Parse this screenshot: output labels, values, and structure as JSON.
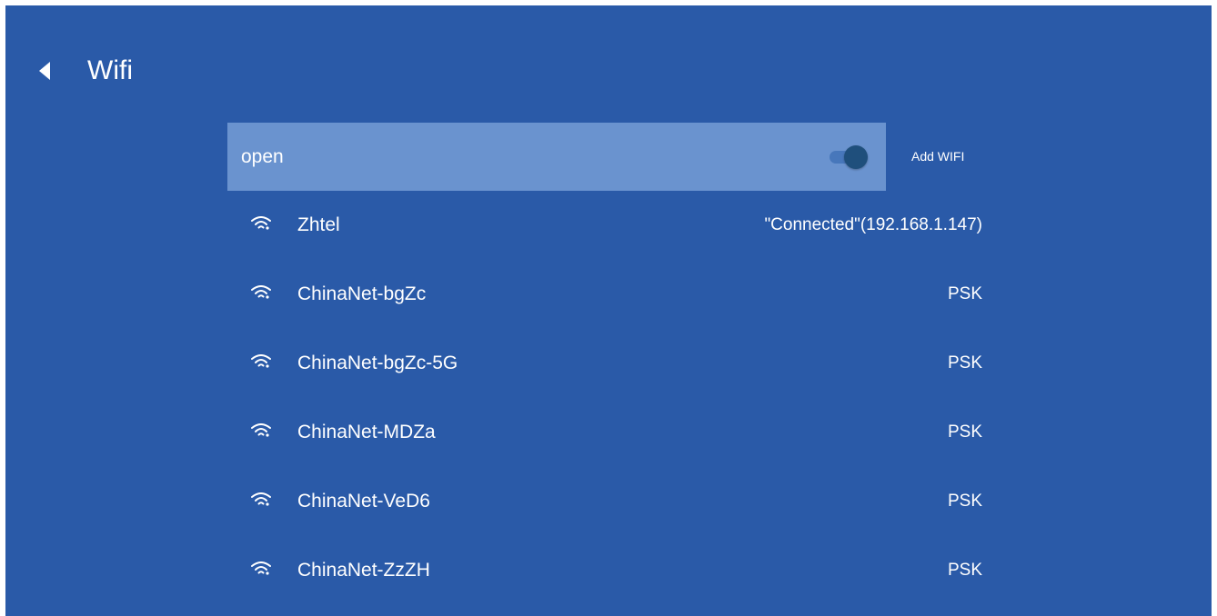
{
  "header": {
    "title": "Wifi",
    "back_icon": "back-arrow-icon"
  },
  "wifi_toggle": {
    "label": "open",
    "enabled": true
  },
  "add_wifi_label": "Add WIFI",
  "networks": [
    {
      "ssid": "Zhtel",
      "status": "\"Connected\"(192.168.1.147)",
      "icon": "wifi-signal-icon"
    },
    {
      "ssid": "ChinaNet-bgZc",
      "status": "PSK",
      "icon": "wifi-signal-icon"
    },
    {
      "ssid": "ChinaNet-bgZc-5G",
      "status": "PSK",
      "icon": "wifi-signal-icon"
    },
    {
      "ssid": "ChinaNet-MDZa",
      "status": "PSK",
      "icon": "wifi-signal-icon"
    },
    {
      "ssid": "ChinaNet-VeD6",
      "status": "PSK",
      "icon": "wifi-signal-icon"
    },
    {
      "ssid": "ChinaNet-ZzZH",
      "status": "PSK",
      "icon": "wifi-signal-icon"
    }
  ],
  "colors": {
    "background": "#2a5aa8",
    "toggle_row": "#6a93cf",
    "switch_track": "#4777bb",
    "switch_thumb": "#1f4f7c",
    "text": "#ffffff"
  }
}
